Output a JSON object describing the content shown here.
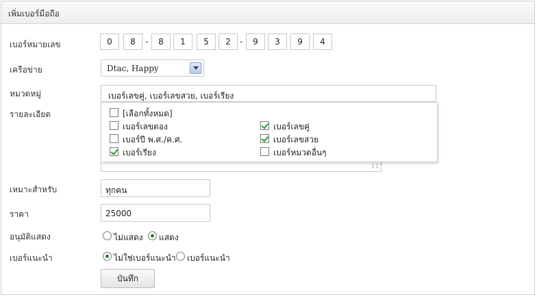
{
  "title": "เพิ่มเบอร์มือถือ",
  "labels": {
    "number": "เบอร์หมายเลข",
    "network": "เครือข่าย",
    "category": "หมวดหมู่",
    "detail": "รายละเอียด",
    "suitable": "เหมาะสำหรับ",
    "price": "ราคา",
    "approve": "อนุมัติแสดง",
    "recommend": "เบอร์แนะนำ"
  },
  "digits": [
    "0",
    "8",
    "8",
    "1",
    "5",
    "2",
    "9",
    "3",
    "9",
    "4"
  ],
  "dash": "-",
  "network": {
    "selected": "Dtac, Happy"
  },
  "category": {
    "summary": "เบอร์เลขคู่, เบอร์เลขสวย, เบอร์เรียง",
    "options": [
      {
        "label": "[เลือกทั้งหมด]",
        "checked": false
      },
      {
        "label": "เบอร์เลขตอง",
        "checked": false
      },
      {
        "label": "เบอร์เลขคู่",
        "checked": true
      },
      {
        "label": "เบอร์ปี พ.ศ./ค.ศ.",
        "checked": false
      },
      {
        "label": "เบอร์เลขสวย",
        "checked": true
      },
      {
        "label": "เบอร์เรียง",
        "checked": true
      },
      {
        "label": "เบอร์หมวดอื่นๆ",
        "checked": false
      }
    ]
  },
  "suitable": {
    "value": "ทุกคน"
  },
  "price": {
    "value": "25000"
  },
  "approve": {
    "options": [
      {
        "label": "ไม่แสดง",
        "selected": false
      },
      {
        "label": "แสดง",
        "selected": true
      }
    ]
  },
  "recommend": {
    "options": [
      {
        "label": "ไม่ใช่เบอร์แนะนำ",
        "selected": true
      },
      {
        "label": "เบอร์แนะนำ",
        "selected": false
      }
    ]
  },
  "save_label": "บันทึก"
}
